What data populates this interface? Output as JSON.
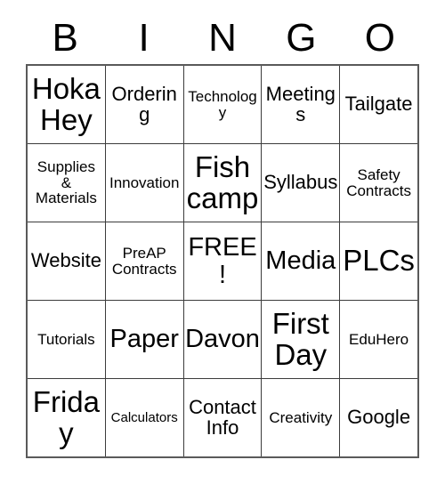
{
  "card": {
    "title": "BINGO",
    "header_letters": [
      "B",
      "I",
      "N",
      "G",
      "O"
    ],
    "free_space": "FREE!",
    "colors": {
      "background": "#ffffff",
      "text": "#000000",
      "grid_line": "#3c3c3c",
      "grid_border": "#5a5a5a"
    },
    "rows": [
      [
        {
          "text": "Hoka Hey",
          "size": "xl"
        },
        {
          "text": "Ordering",
          "size": "md"
        },
        {
          "text": "Technology",
          "size": "sm"
        },
        {
          "text": "Meetings",
          "size": "md"
        },
        {
          "text": "Tailgate",
          "size": "md"
        }
      ],
      [
        {
          "text": "Supplies\n&\nMaterials",
          "size": "sm"
        },
        {
          "text": "Innovation",
          "size": "sm"
        },
        {
          "text": "Fish camp",
          "size": "xl"
        },
        {
          "text": "Syllabus",
          "size": "md"
        },
        {
          "text": "Safety\nContracts",
          "size": "sm"
        }
      ],
      [
        {
          "text": "Website",
          "size": "md"
        },
        {
          "text": "PreAP\nContracts",
          "size": "sm"
        },
        {
          "text": "FREE!",
          "size": "lg"
        },
        {
          "text": "Media",
          "size": "lg"
        },
        {
          "text": "PLCs",
          "size": "xl"
        }
      ],
      [
        {
          "text": "Tutorials",
          "size": "sm"
        },
        {
          "text": "Paper",
          "size": "lg"
        },
        {
          "text": "Davon",
          "size": "lg"
        },
        {
          "text": "First Day",
          "size": "xl"
        },
        {
          "text": "EduHero",
          "size": "sm"
        }
      ],
      [
        {
          "text": "Friday",
          "size": "xl"
        },
        {
          "text": "Calculators",
          "size": "xs"
        },
        {
          "text": "Contact\nInfo",
          "size": "md"
        },
        {
          "text": "Creativity",
          "size": "sm"
        },
        {
          "text": "Google",
          "size": "md"
        }
      ]
    ]
  }
}
